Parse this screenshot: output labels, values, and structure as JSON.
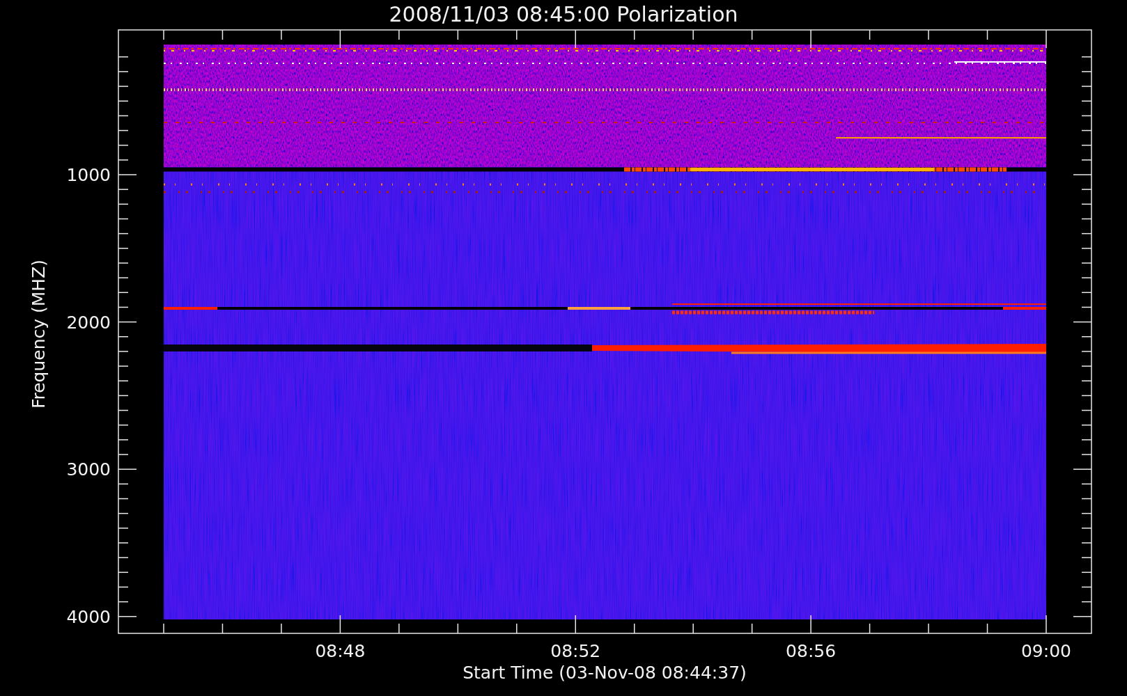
{
  "title": "2008/11/03 08:45:00 Polarization",
  "ylabel": "Frequency (MHZ)",
  "xlabel": "Start Time (03-Nov-08 08:44:37)",
  "yticks": [
    "1000",
    "2000",
    "3000",
    "4000"
  ],
  "xticks": [
    "08:48",
    "08:52",
    "08:56",
    "09:00"
  ]
}
